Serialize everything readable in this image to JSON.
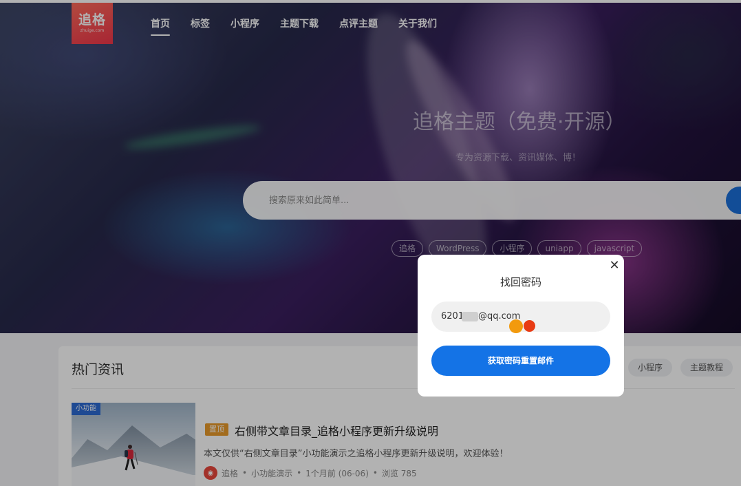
{
  "header": {
    "logo_main": "追格",
    "logo_sub": "zhuige.com",
    "nav": [
      "首页",
      "标签",
      "小程序",
      "主题下载",
      "点评主题",
      "关于我们"
    ]
  },
  "hero": {
    "title": "追格主题（免费·开源）",
    "subtitle": "专为资源下载、资讯媒体、博！",
    "search_placeholder": "搜索原来如此简单...",
    "tags": [
      "追格",
      "WordPress",
      "小程序",
      "uniapp",
      "javascript"
    ]
  },
  "hot": {
    "title": "热门资讯",
    "chips": [
      "小程序",
      "主题教程"
    ]
  },
  "post": {
    "badge": "小功能",
    "top_label": "置顶",
    "title": "右侧带文章目录_追格小程序更新升级说明",
    "excerpt": "本文仅供“右侧文章目录”小功能演示之追格小程序更新升级说明，欢迎体验！",
    "author": "追格",
    "category": "小功能演示",
    "time": "1个月前 (06-06)",
    "views": "浏览 785"
  },
  "modal": {
    "title": "找回密码",
    "email_prefix": "6201",
    "email_suffix": "@qq.com",
    "submit": "获取密码重置邮件"
  },
  "colors": {
    "primary": "#1473e6",
    "logo": "#f0364a",
    "top_badge": "#e89a2a"
  }
}
